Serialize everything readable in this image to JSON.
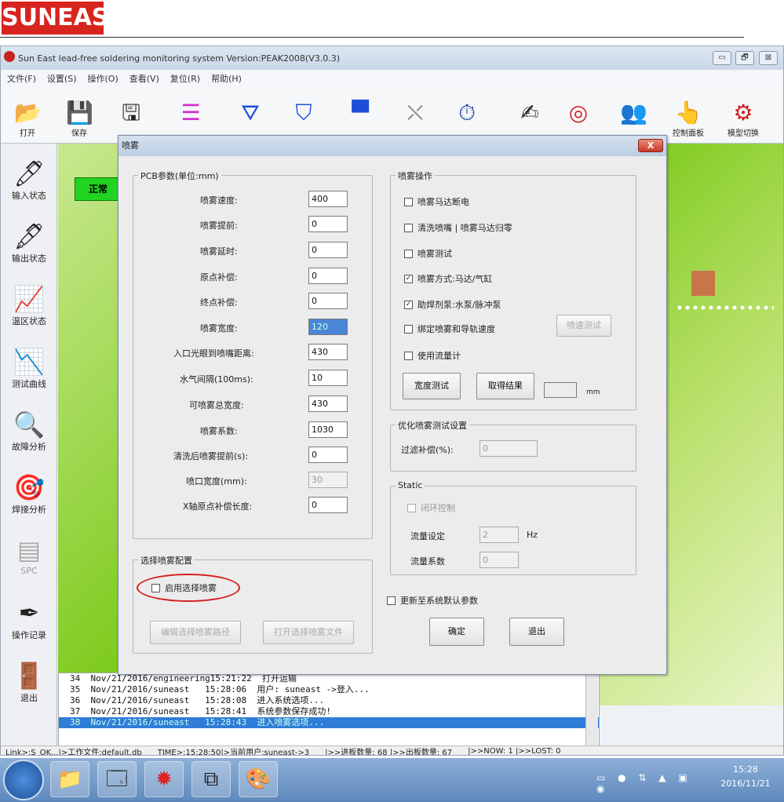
{
  "logo": "SUNEAST",
  "window": {
    "title": "Sun East lead-free soldering monitoring system Version:PEAK2008(V3.0.3)",
    "min": "▭",
    "max": "🗗",
    "close": "⊠"
  },
  "menu": [
    "文件(F)",
    "设置(S)",
    "操作(O)",
    "查看(V)",
    "复位(R)",
    "帮助(H)"
  ],
  "toolbar": {
    "open_label": "打开",
    "save_label": "保存",
    "control_label": "控制面板",
    "mode_label": "模型切换"
  },
  "sidebar": [
    {
      "label": "输入状态"
    },
    {
      "label": "输出状态"
    },
    {
      "label": "温区状态"
    },
    {
      "label": "测试曲线"
    },
    {
      "label": "故障分析"
    },
    {
      "label": "焊接分析"
    },
    {
      "label": "SPC"
    },
    {
      "label": "操作记录"
    },
    {
      "label": "退出"
    }
  ],
  "status_indicator": "正常",
  "log": [
    "34  Nov/21/2016/engineering15:21:22  打开运输",
    "35  Nov/21/2016/suneast   15:28:06  用户: suneast ->登入...",
    "36  Nov/21/2016/suneast   15:28:08  进入系统选项...",
    "37  Nov/21/2016/suneast   15:28:41  系统参数保存成功!",
    "38  Nov/21/2016/suneast   15:28:43  进入喷雾选项..."
  ],
  "statusbar": {
    "link": "Link>:S_OK...|>工作文件:default.db",
    "time": "TIME>:15:28:50|>当前用户:suneast->3",
    "in_count": "|>>进板数量:  68 |>>出板数量:  67",
    "now": "|>>NOW:   1 |>>LOST:   0"
  },
  "dialog": {
    "title": "喷雾",
    "close": "X",
    "pcb_group": {
      "label": "PCB参数(单位:mm)",
      "fields": [
        {
          "label": "喷雾速度:",
          "value": "400"
        },
        {
          "label": "喷雾提前:",
          "value": "0"
        },
        {
          "label": "喷雾延时:",
          "value": "0"
        },
        {
          "label": "原点补偿:",
          "value": "0"
        },
        {
          "label": "终点补偿:",
          "value": "0"
        },
        {
          "label": "喷雾宽度:",
          "value": "120"
        },
        {
          "label": "入口光眼到喷嘴距离:",
          "value": "430"
        },
        {
          "label": "水气间隔(100ms):",
          "value": "10"
        },
        {
          "label": "可喷雾总宽度:",
          "value": "430"
        },
        {
          "label": "喷雾系数:",
          "value": "1030"
        },
        {
          "label": "清洗后喷雾提前(s):",
          "value": "0"
        },
        {
          "label": "喷口宽度(mm):",
          "value": "30"
        },
        {
          "label": "X轴原点补偿长度:",
          "value": "0"
        }
      ]
    },
    "spray_ops": {
      "label": "喷雾操作",
      "checks": [
        {
          "label": "喷雾马达断电",
          "checked": false
        },
        {
          "label": "清洗喷嘴 | 喷雾马达归零",
          "checked": false
        },
        {
          "label": "喷雾测试",
          "checked": false
        },
        {
          "label": "喷雾方式:马达/气缸",
          "checked": true
        },
        {
          "label": "助焊剂泵:水泵/脉冲泵",
          "checked": true
        },
        {
          "label": "绑定喷雾和导轨速度",
          "checked": false
        },
        {
          "label": "使用流量计",
          "checked": false
        }
      ],
      "speed_test_btn": "喷速测试",
      "width_test_btn": "宽度测试",
      "get_result_btn": "取得结果",
      "unit": "mm"
    },
    "optimize": {
      "label": "优化喷雾测试设置",
      "filter_label": "过滤补偿(%):",
      "filter_value": "0"
    },
    "static_group": {
      "label": "Static",
      "closed_loop": "闭环控制",
      "flow_set_label": "流量设定",
      "flow_set_value": "2",
      "flow_unit": "Hz",
      "flow_coef_label": "流量系数",
      "flow_coef_value": "0"
    },
    "select_group": {
      "label": "选择喷雾配置",
      "enable": "启用选择喷雾",
      "edit_btn": "编辑选择喷雾路径",
      "open_btn": "打开选择喷雾文件"
    },
    "update_default": "更新至系统默认参数",
    "ok": "确定",
    "exit": "退出"
  },
  "taskbar": {
    "time": "15:28",
    "date": "2016/11/21"
  }
}
